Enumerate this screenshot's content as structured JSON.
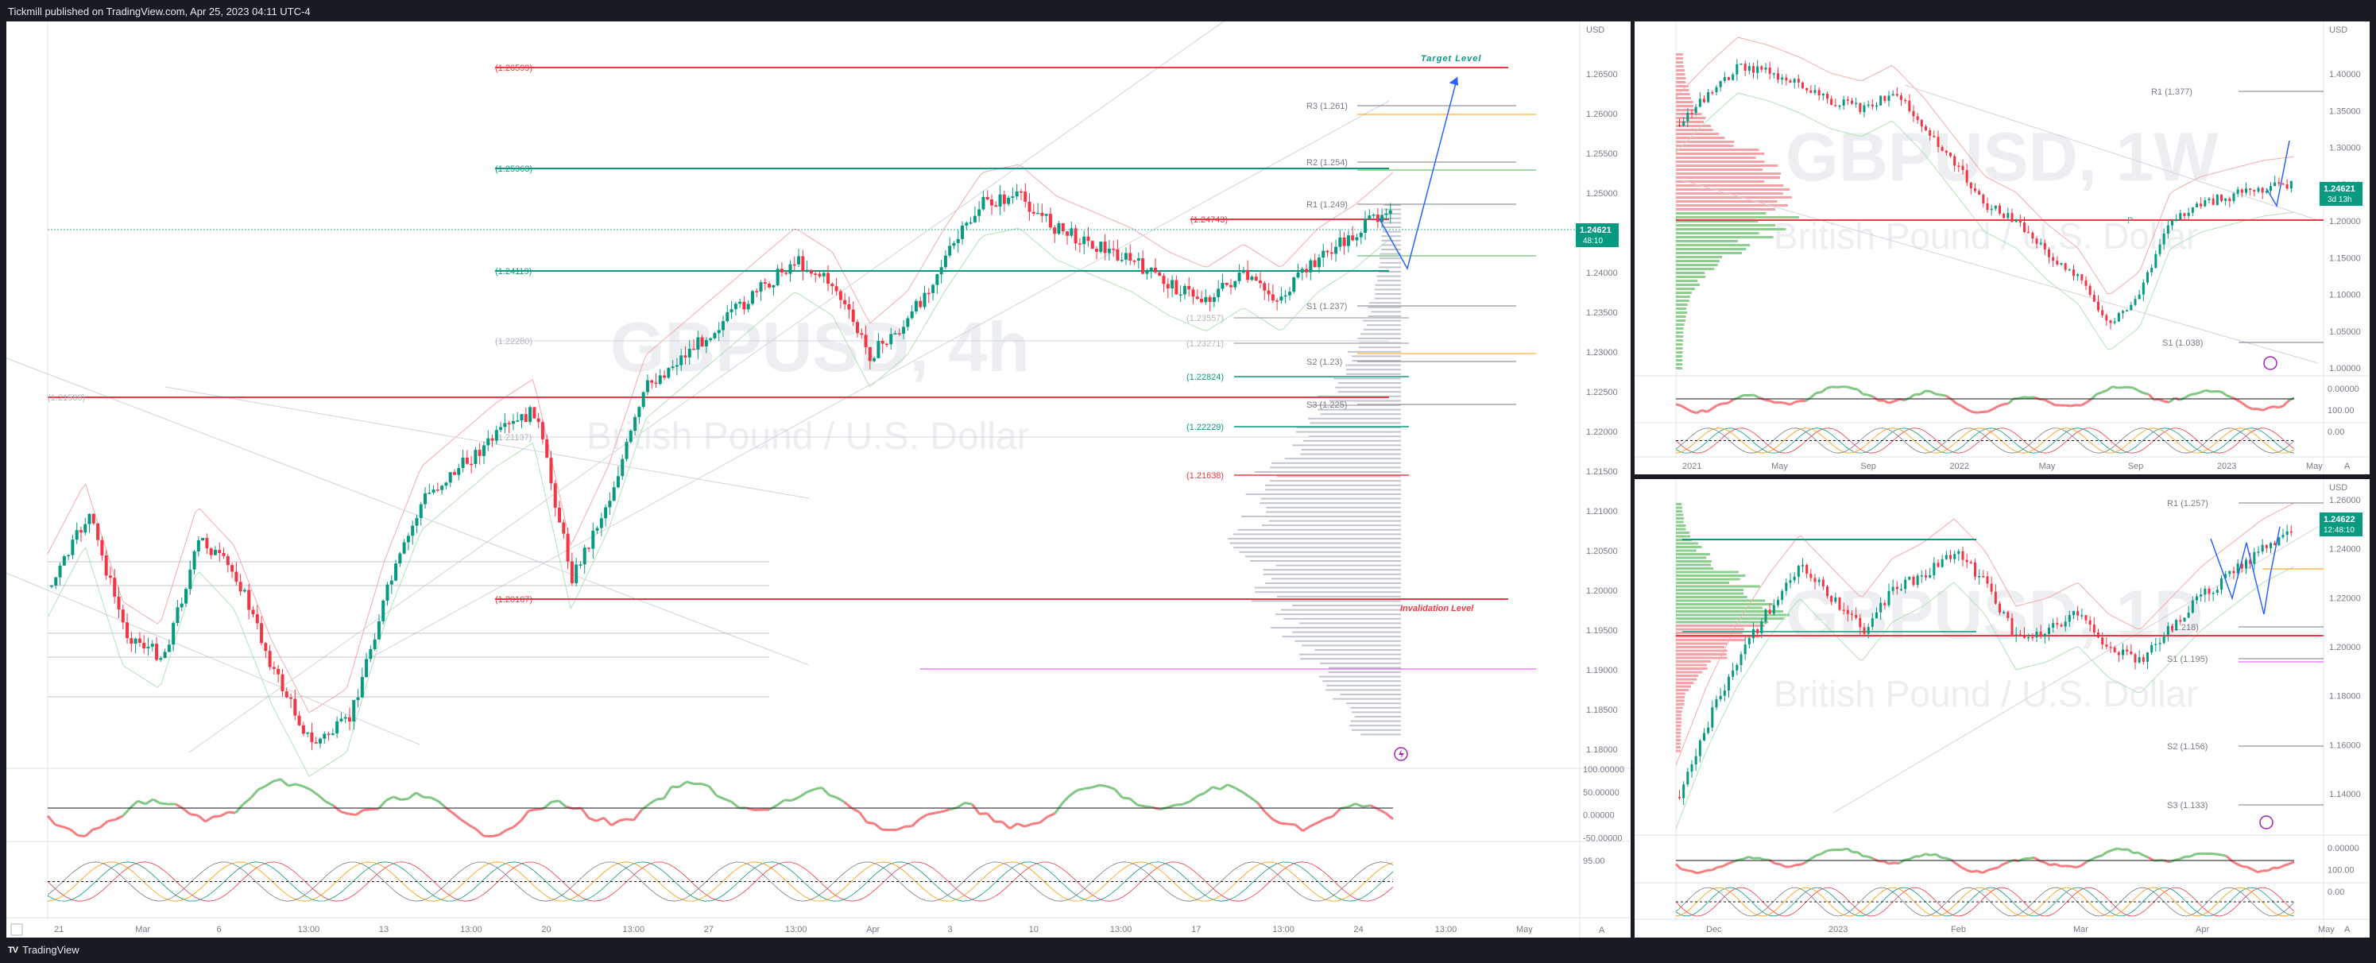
{
  "header": {
    "publisher": "Tickmill published on TradingView.com, Apr 25, 2023 04:11 UTC-4"
  },
  "footer": {
    "brand": "TradingView"
  },
  "main_chart": {
    "watermark_symbol": "GBPUSD, 4h",
    "watermark_name": "British Pound / U.S. Dollar",
    "price_label": "1.24621",
    "countdown": "48:10",
    "axis_unit": "USD",
    "price_axis": [
      "1.26500",
      "1.26000",
      "1.25500",
      "1.25000",
      "1.24500",
      "1.24000",
      "1.23500",
      "1.23000",
      "1.22500",
      "1.22000",
      "1.21500",
      "1.21000",
      "1.20500",
      "1.20000",
      "1.19500",
      "1.19000",
      "1.18500",
      "1.18000"
    ],
    "time_axis": [
      "21",
      "Mar",
      "6",
      "13:00",
      "13",
      "13:00",
      "20",
      "13:00",
      "27",
      "13:00",
      "Apr",
      "3",
      "10",
      "13:00",
      "17",
      "13:00",
      "24",
      "13:00",
      "May"
    ],
    "target_label": "Target Level",
    "invalidation_label": "Invalidation Level",
    "levels": [
      {
        "text": "(1.26599)",
        "color": "#f23645"
      },
      {
        "text": "(1.25363)",
        "color": "#089981"
      },
      {
        "text": "(1.24743)",
        "color": "#f23645"
      },
      {
        "text": "(1.24119)",
        "color": "#089981"
      },
      {
        "text": "(1.22280)",
        "color": "#b2b5be"
      },
      {
        "text": "(1.21586)",
        "color": "#b2b5be"
      },
      {
        "text": "(1.21137)",
        "color": "#b2b5be"
      },
      {
        "text": "(1.20107)",
        "color": "#f23645"
      }
    ],
    "fibs": [
      {
        "text": "(1.23557)",
        "color": "#b2b5be"
      },
      {
        "text": "(1.23271)",
        "color": "#b2b5be"
      },
      {
        "text": "(1.22824)",
        "color": "#089981"
      },
      {
        "text": "(1.22229)",
        "color": "#089981"
      },
      {
        "text": "(1.21638)",
        "color": "#f23645"
      }
    ],
    "pivots": [
      "R3 (1.261)",
      "R2 (1.254)",
      "R1 (1.249)",
      "S1 (1.237)",
      "S2 (1.23)",
      "S3 (1.225)"
    ],
    "osc_axis": [
      "100.00000",
      "50.00000",
      "0.00000",
      "-50.00000",
      "95.00"
    ],
    "scale_btn": "A"
  },
  "weekly_chart": {
    "watermark_symbol": "GBPUSD, 1W",
    "watermark_name": "British Pound / U.S. Dollar",
    "price_label": "1.24621",
    "countdown": "3d 13h",
    "axis_unit": "USD",
    "price_axis": [
      "1.40000",
      "1.35000",
      "1.30000",
      "1.25000",
      "1.20000",
      "1.15000",
      "1.10000",
      "1.05000",
      "1.00000"
    ],
    "time_axis": [
      "2021",
      "May",
      "Sep",
      "2022",
      "May",
      "Sep",
      "2023",
      "May"
    ],
    "pivots": [
      "R1 (1.377)",
      "S1 (1.038)"
    ],
    "pivot_p": "P",
    "osc_axis": [
      "0.00000",
      "100.00",
      "0.00"
    ],
    "scale_btn": "A"
  },
  "daily_chart": {
    "watermark_symbol": "GBPUSD, 1D",
    "watermark_name": "British Pound / U.S. Dollar",
    "price_label": "1.24622",
    "countdown": "12:48:10",
    "axis_unit": "USD",
    "price_axis": [
      "1.26000",
      "1.24000",
      "1.22000",
      "1.20000",
      "1.18000",
      "1.16000",
      "1.14000"
    ],
    "time_axis": [
      "Dec",
      "2023",
      "Feb",
      "Mar",
      "Apr",
      "May"
    ],
    "pivots": [
      "R1 (1.257)",
      "(1.218)",
      "S1 (1.195)",
      "S2 (1.156)",
      "S3 (1.133)"
    ],
    "osc_axis": [
      "0.00000",
      "100.00",
      "0.00"
    ],
    "scale_btn": "A"
  },
  "colors": {
    "up": "#089981",
    "down": "#f23645",
    "blue": "#2962ff",
    "bg": "#181b21"
  }
}
